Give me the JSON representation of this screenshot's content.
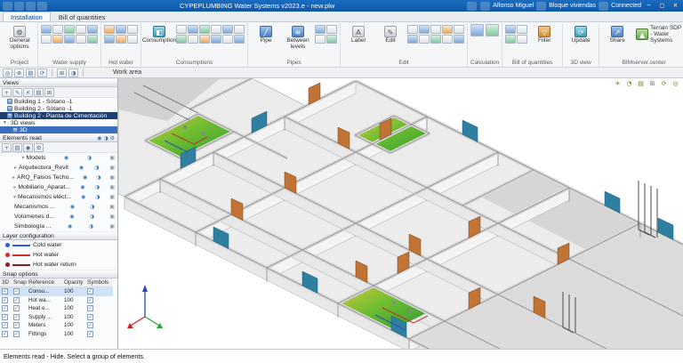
{
  "title_bar": {
    "title": "CYPEPLUMBING Water Systems v2023.e - new.plw",
    "user": "Alfonso Miguel",
    "project": "Bloque viviendas",
    "connection": "Connected",
    "window": {
      "minimize": "─",
      "maximize": "▢",
      "close": "✕"
    }
  },
  "tabs": {
    "installation": "Installation",
    "bill_of_quantities": "Bill of quantities"
  },
  "ribbon": {
    "project": {
      "caption": "Project",
      "general_options": "General options"
    },
    "water_supply": {
      "caption": "Water supply"
    },
    "hot_water": {
      "caption": "Hot water"
    },
    "consumptions": {
      "caption": "Consumptions",
      "consumption": "Consumption"
    },
    "pipes": {
      "caption": "Pipes",
      "pipe": "Pipe",
      "between_levels": "Between levels"
    },
    "edit": {
      "caption": "Edit",
      "label": "Label",
      "edit": "Edit"
    },
    "calculation": {
      "caption": "Calculation"
    },
    "bill_of_quantities": {
      "caption": "Bill of quantities",
      "filter": "Filter"
    },
    "view3d": {
      "caption": "3D view",
      "update": "Update"
    },
    "bimserver": {
      "caption": "BIMserver.center",
      "share": "Share",
      "terrain": "Terrain SDP - Water Systems"
    }
  },
  "work_area": {
    "label": "Work area"
  },
  "views_panel": {
    "title": "Views",
    "items": [
      {
        "label": "Building 1 - Sótano -1"
      },
      {
        "label": "Building 2 - Sótano -1"
      },
      {
        "label": "Building 2 - Planta de Cimentación"
      },
      {
        "label": "3D views"
      },
      {
        "label": "3D"
      }
    ]
  },
  "elements_panel": {
    "title": "Elements read",
    "items": [
      {
        "label": "Models"
      },
      {
        "label": "Arquitectura_Revit"
      },
      {
        "label": "ARQ_Falsos Techo..."
      },
      {
        "label": "Mobiliario_Aparat..."
      },
      {
        "label": "Mecanismos eléct..."
      },
      {
        "label": "Mecanismos ..."
      },
      {
        "label": "Volúmenes d..."
      },
      {
        "label": "Simbología ..."
      }
    ]
  },
  "layer_panel": {
    "title": "Layer configuration",
    "layers": [
      {
        "label": "Cold water",
        "color": "#2b5fd9"
      },
      {
        "label": "Hot water",
        "color": "#d92b2b"
      },
      {
        "label": "Hot water return",
        "color": "#8f1d1d"
      }
    ]
  },
  "snap_panel": {
    "title": "Snap options",
    "columns": {
      "c0": "3D",
      "c1": "Snap",
      "c2": "Reference",
      "c3": "Opacity",
      "c4": "Symbols"
    },
    "rows": [
      {
        "name": "Consu...",
        "opacity": "100"
      },
      {
        "name": "Hot wa...",
        "opacity": "100"
      },
      {
        "name": "Heat e...",
        "opacity": "100"
      },
      {
        "name": "Supply ...",
        "opacity": "100"
      },
      {
        "name": "Meters",
        "opacity": "100"
      },
      {
        "name": "Fittings",
        "opacity": "100"
      }
    ]
  },
  "status_bar": {
    "message": "Elements read - Hide. Select a group of elements."
  },
  "icons": {
    "gear": "⚙",
    "pencil": "✎",
    "label_a": "A",
    "funnel": "▽",
    "refresh": "⟳",
    "share": "↗",
    "terrain": "▲",
    "tap": "◧",
    "levels": "≋",
    "pipe": "╱",
    "eye": "◉",
    "half": "◑",
    "lock": "▣",
    "add": "+",
    "close": "✕",
    "grid": "▤",
    "cube": "⊞",
    "orbit": "◔",
    "target": "◎",
    "sun": "☀",
    "zoom": "⊕",
    "check": "✓",
    "chev_down": "▾",
    "chev_right": "▸"
  }
}
